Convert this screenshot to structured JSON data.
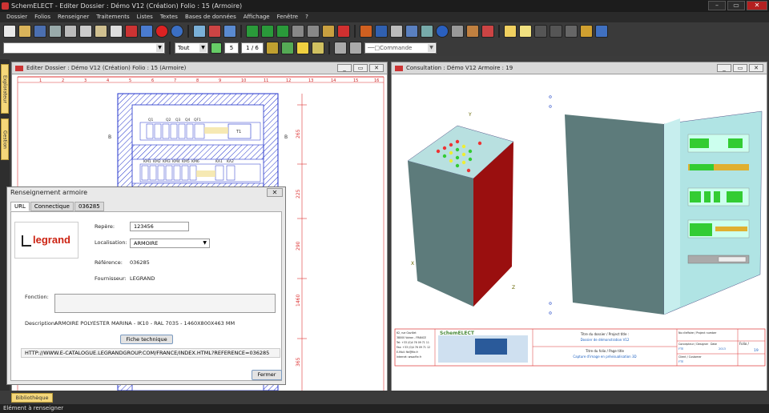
{
  "app": {
    "title": "SchemELECT - Editer  Dossier : Démo V12  (Création)  Folio : 15  (Armoire)"
  },
  "menu": [
    "Dossier",
    "Folios",
    "Renseigner",
    "Traitements",
    "Listes",
    "Textes",
    "Bases de données",
    "Affichage",
    "Fenêtre",
    "?"
  ],
  "toolbar2": {
    "zoom_mode": "Tout",
    "page_value": "5",
    "page_count": "1 / 6",
    "command": "Commande"
  },
  "sidebar": {
    "tab1": "Explorateur",
    "tab2": "Gestion"
  },
  "editor": {
    "title": "Editer  Dossier : Démo V12  (Création)  Folio : 15  (Armoire)",
    "dims": [
      "265",
      "225",
      "290",
      "1460",
      "365"
    ],
    "ruler_top": [
      "1",
      "2",
      "3",
      "4",
      "5",
      "6",
      "7",
      "8",
      "9",
      "10",
      "11",
      "12",
      "13",
      "14",
      "15",
      "16"
    ],
    "ruler_left": [
      "1",
      "2",
      "3",
      "4",
      "5",
      "6",
      "7"
    ],
    "side_labels": {
      "left": "B",
      "right": "B"
    },
    "rows": {
      "top": [
        "Q1",
        "Q2",
        "Q3",
        "Q4",
        "QF1"
      ],
      "middle": [
        "KM1",
        "KM2",
        "KM3",
        "KM4",
        "KM5",
        "KM6",
        "KA1",
        "KA2"
      ],
      "box": "T1"
    }
  },
  "dialog": {
    "title": "Renseignement armoire",
    "tabs": [
      "URL",
      "Connectique",
      "036285"
    ],
    "brand": "legrand",
    "repere_label": "Repère:",
    "repere_value": "123456",
    "localisation_label": "Localisation:",
    "localisation_value": "ARMOIRE",
    "reference_label": "Référence:",
    "reference_value": "036285",
    "fournisseur_label": "Fournisseur:",
    "fournisseur_value": "LEGRAND",
    "fonction_label": "Fonction:",
    "fonction_value": "",
    "description_label": "Description:",
    "description_value": "ARMOIRE POLYESTER MARINA - IK10 - RAL 7035 - 1460X800X463 MM",
    "fiche_button": "Fiche technique",
    "url": "HTTP://WWW.E-CATALOGUE.LEGRANDGROUP.COM/FRANCE/INDEX.HTML?REFERENCE=036285",
    "close_button": "Fermer"
  },
  "viewer": {
    "title": "Consultation : Démo V12  Armoire : 19",
    "labels": {
      "y": "Y",
      "z": "Z",
      "x": "X"
    },
    "cartouche": {
      "logo": "SchemELECT",
      "dossier_title": "Titre du dossier / Project title :",
      "dossier_value": "Dossier de démonstration V12",
      "folio_title": "Titre du folio / Page title",
      "folio_value": "Capture d'image en prévisualisation 3D",
      "affaire": "No d'affaire / Project number",
      "concepteur": "Concepteur / Designer",
      "date": "Date",
      "author": "FTE",
      "year": "2013",
      "client": "Client / Customer",
      "client_value": "FTE",
      "folio_label": "Folio /",
      "folio_num": "19",
      "address": [
        "62, rue Gavillet",
        "38000 Voiron - FRANCE",
        "Tel: +33 (0)4 76 09 71 11",
        "Fax: +33 (0)4 76 09 71 12",
        "E-Mail: fte@fte.fr",
        "Internet: www.fte.fr"
      ]
    }
  },
  "bottom": {
    "biblio": "Bibliothèque",
    "status": "Elément à renseigner"
  }
}
